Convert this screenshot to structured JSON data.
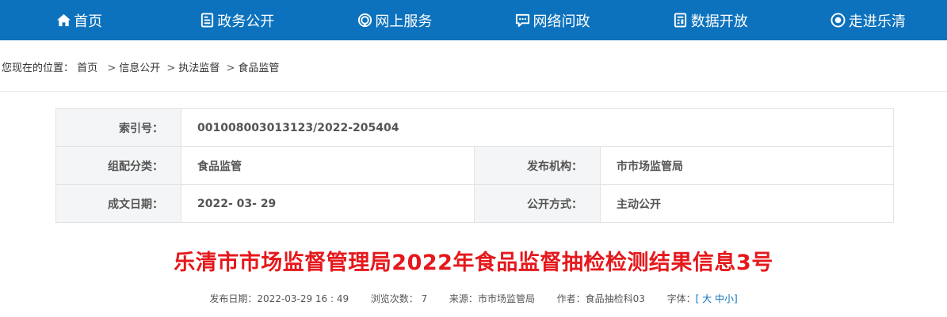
{
  "nav": {
    "items": [
      {
        "label": "首页",
        "icon": "home-icon"
      },
      {
        "label": "政务公开",
        "icon": "document-icon"
      },
      {
        "label": "网上服务",
        "icon": "service-icon"
      },
      {
        "label": "网络问政",
        "icon": "chat-icon"
      },
      {
        "label": "数据开放",
        "icon": "data-icon"
      },
      {
        "label": "走进乐清",
        "icon": "eye-icon"
      }
    ],
    "bg_color": "#0c72bd"
  },
  "breadcrumb": {
    "prefix": "您现在的位置：",
    "items": [
      "首页",
      "信息公开",
      "执法监督",
      "食品监管"
    ]
  },
  "info": {
    "index_label": "索引号：",
    "index_value": "001008003013123/2022-205404",
    "category_label": "组配分类：",
    "category_value": "食品监管",
    "publisher_label": "发布机构：",
    "publisher_value": "市市场监管局",
    "date_label": "成文日期：",
    "date_value": "2022- 03- 29",
    "mode_label": "公开方式：",
    "mode_value": "主动公开"
  },
  "article": {
    "title": "乐清市市场监督管理局2022年食品监督抽检检测结果信息3号",
    "title_color": "#e5181c",
    "publish_label": "发布日期：",
    "publish_value": "2022-03-29 16 : 49",
    "views_label": "浏览次数：",
    "views_value": "7",
    "source_label": "来源：",
    "source_value": "市市场监管局",
    "author_label": "作者：",
    "author_value": "食品抽检科03",
    "font_label": "字体：",
    "font_open": "[",
    "font_large": "大",
    "font_medium": "中",
    "font_small": "小",
    "font_close": "]"
  }
}
